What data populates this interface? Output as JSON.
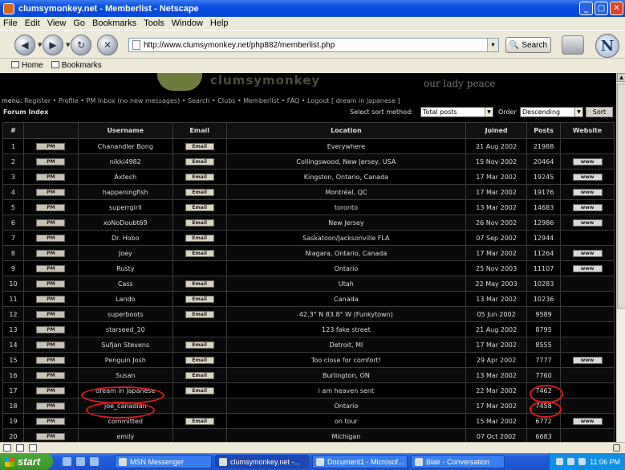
{
  "window": {
    "title": "clumsymonkey.net - Memberlist - Netscape"
  },
  "menubar": [
    "File",
    "Edit",
    "View",
    "Go",
    "Bookmarks",
    "Tools",
    "Window",
    "Help"
  ],
  "address": {
    "url": "http://www.clumsymonkey.net/php882/memberlist.php"
  },
  "search_button": "Search",
  "netscape_logo": "N",
  "personal_toolbar": {
    "home": "Home",
    "bookmarks": "Bookmarks"
  },
  "banner": {
    "tagline": "our lady peace"
  },
  "site_menu": {
    "label": "menu:",
    "items": [
      "Register",
      "Profile",
      "PM Inbox (no new messages)",
      "Search",
      "Clubs",
      "Memberlist",
      "FAQ",
      "Logout [ dream in japanese ]"
    ]
  },
  "forum_index": "Forum Index",
  "sort": {
    "method_label": "Select sort method:",
    "method_value": "Total posts",
    "order_label": "Order",
    "order_value": "Descending",
    "button": "Sort"
  },
  "table": {
    "headers": [
      "#",
      "",
      "Username",
      "Email",
      "Location",
      "Joined",
      "Posts",
      "Website"
    ],
    "pm_label": "PM",
    "email_label": "Email",
    "www_label": "www",
    "rows": [
      {
        "n": "1",
        "user": "Chanandler Bong",
        "email": true,
        "location": "Everywhere",
        "joined": "21 Aug 2002",
        "posts": "21988",
        "www": false
      },
      {
        "n": "2",
        "user": "nikki4982",
        "email": true,
        "location": "Collingswood, New Jersey, USA",
        "joined": "15 Nov 2002",
        "posts": "20464",
        "www": true
      },
      {
        "n": "3",
        "user": "Axtech",
        "email": true,
        "location": "Kingston, Ontario, Canada",
        "joined": "17 Mar 2002",
        "posts": "19245",
        "www": true
      },
      {
        "n": "4",
        "user": "happeningfish",
        "email": true,
        "location": "Montréal, QC",
        "joined": "17 Mar 2002",
        "posts": "19176",
        "www": true
      },
      {
        "n": "5",
        "user": "superrgirll",
        "email": true,
        "location": "toronto",
        "joined": "13 Mar 2002",
        "posts": "14683",
        "www": true
      },
      {
        "n": "6",
        "user": "xoNoDoubt69",
        "email": true,
        "location": "New Jersey",
        "joined": "26 Nov 2002",
        "posts": "12986",
        "www": true
      },
      {
        "n": "7",
        "user": "Dr. Hobo",
        "email": true,
        "location": "Saskatoon/Jacksonville FLA",
        "joined": "07 Sep 2002",
        "posts": "12944",
        "www": false
      },
      {
        "n": "8",
        "user": "Joey",
        "email": true,
        "location": "Niagara, Ontario, Canada",
        "joined": "17 Mar 2002",
        "posts": "11264",
        "www": true
      },
      {
        "n": "9",
        "user": "Rusty",
        "email": false,
        "location": "Ontario",
        "joined": "25 Nov 2003",
        "posts": "11107",
        "www": true
      },
      {
        "n": "10",
        "user": "Cass",
        "email": true,
        "location": "Utah",
        "joined": "22 May 2003",
        "posts": "10283",
        "www": false
      },
      {
        "n": "11",
        "user": "Lando",
        "email": true,
        "location": "Canada",
        "joined": "13 Mar 2002",
        "posts": "10236",
        "www": false
      },
      {
        "n": "12",
        "user": "superboots",
        "email": true,
        "location": "42.3° N 83.8° W (Funkytown)",
        "joined": "05 Jun 2002",
        "posts": "9589",
        "www": false
      },
      {
        "n": "13",
        "user": "starseed_10",
        "email": false,
        "location": "123 fake street",
        "joined": "21 Aug 2002",
        "posts": "8795",
        "www": false
      },
      {
        "n": "14",
        "user": "Sufjan Stevens",
        "email": true,
        "location": "Detroit, MI",
        "joined": "17 Mar 2002",
        "posts": "8555",
        "www": false
      },
      {
        "n": "15",
        "user": "Penguin Josh",
        "email": true,
        "location": "Too close for comfort!",
        "joined": "29 Apr 2002",
        "posts": "7777",
        "www": true
      },
      {
        "n": "16",
        "user": "Susan",
        "email": true,
        "location": "Burlington, ON",
        "joined": "13 Mar 2002",
        "posts": "7760",
        "www": false
      },
      {
        "n": "17",
        "user": "dream in japanese",
        "email": true,
        "location": "i am heaven sent",
        "joined": "22 Mar 2002",
        "posts": "7462",
        "www": false
      },
      {
        "n": "18",
        "user": "joe_canadian",
        "email": false,
        "location": "Ontario",
        "joined": "17 Mar 2002",
        "posts": "7458",
        "www": false
      },
      {
        "n": "19",
        "user": "committed",
        "email": true,
        "location": "on tour",
        "joined": "15 Mar 2002",
        "posts": "6772",
        "www": true
      },
      {
        "n": "20",
        "user": "emily",
        "email": false,
        "location": "Michigan",
        "joined": "07 Oct 2002",
        "posts": "6683",
        "www": false
      }
    ]
  },
  "taskbar": {
    "start": "start",
    "tasks": [
      "MSN Messenger",
      "clumsymonkey.net -...",
      "Document1 - Microsof...",
      "Blair - Conversation"
    ],
    "clock": "11:06 PM"
  }
}
